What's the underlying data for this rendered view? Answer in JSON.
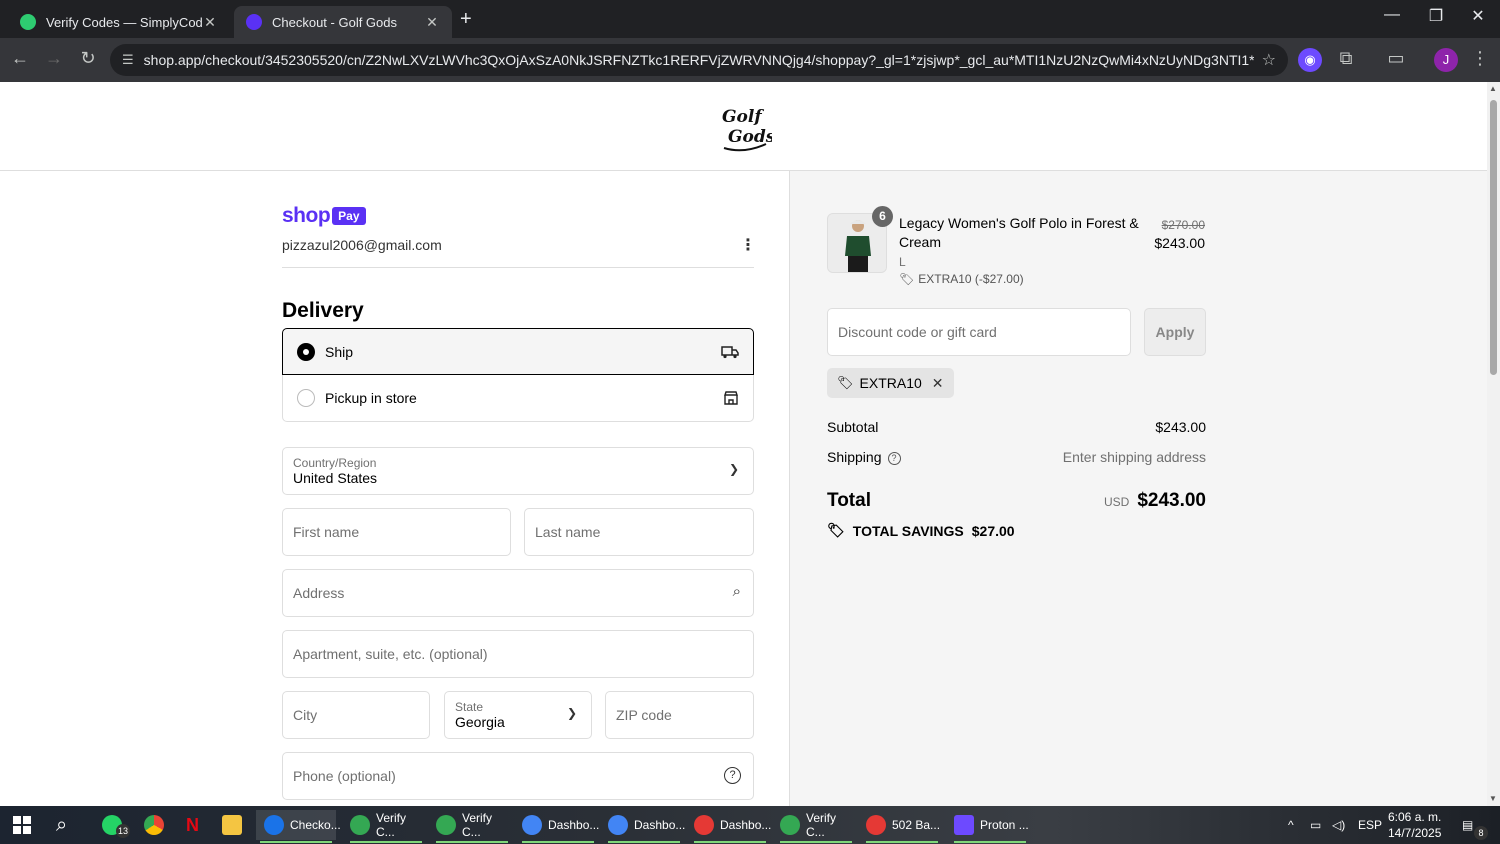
{
  "browser": {
    "tabs": [
      {
        "title": "Verify Codes — SimplyCodes",
        "active": false
      },
      {
        "title": "Checkout - Golf Gods",
        "active": true
      }
    ],
    "url": "shop.app/checkout/3452305520/cn/Z2NwLXVzLWVhc3QxOjAxSzA0NkJSRFNZTkc1RERFVjZWRVNNQjg4/shoppay?_gl=1*zjsjwp*_gcl_au*MTI1NzU2NzQwMi4xNzUyNDg3NTI1*_ga*MTkwM...",
    "profile_initial": "J"
  },
  "store": {
    "logo_text": "Golf Gods"
  },
  "checkout": {
    "shoppay_shop": "shop",
    "shoppay_pay": "Pay",
    "email": "pizzazul2006@gmail.com",
    "delivery_heading": "Delivery",
    "options": {
      "ship": "Ship",
      "pickup": "Pickup in store"
    },
    "fields": {
      "country_label": "Country/Region",
      "country_value": "United States",
      "first_name": "First name",
      "last_name": "Last name",
      "address": "Address",
      "apartment": "Apartment, suite, etc. (optional)",
      "city": "City",
      "state_label": "State",
      "state_value": "Georgia",
      "zip": "ZIP code",
      "phone": "Phone (optional)"
    }
  },
  "summary": {
    "item": {
      "quantity": "6",
      "name": "Legacy Women's Golf Polo in Forest & Cream",
      "variant": "L",
      "discount": "EXTRA10 (-$27.00)",
      "original_price": "$270.00",
      "price": "$243.00"
    },
    "discount_placeholder": "Discount code or gift card",
    "apply_label": "Apply",
    "applied_code": "EXTRA10",
    "subtotal_label": "Subtotal",
    "subtotal_value": "$243.00",
    "shipping_label": "Shipping",
    "shipping_value": "Enter shipping address",
    "total_label": "Total",
    "currency": "USD",
    "total_value": "$243.00",
    "savings_label": "TOTAL SAVINGS",
    "savings_value": "$27.00"
  },
  "taskbar": {
    "whatsapp_badge": "13",
    "items": [
      {
        "label": "Checko...",
        "color": "#1a73e8"
      },
      {
        "label": "Verify C...",
        "color": "#34a853"
      },
      {
        "label": "Verify C...",
        "color": "#34a853"
      },
      {
        "label": "Dashbo...",
        "color": "#4285f4"
      },
      {
        "label": "Dashbo...",
        "color": "#4285f4"
      },
      {
        "label": "Dashbo...",
        "color": "#e53935"
      },
      {
        "label": "Verify C...",
        "color": "#34a853"
      },
      {
        "label": "502 Ba...",
        "color": "#e53935"
      },
      {
        "label": "Proton ...",
        "color": "#6d4aff"
      }
    ],
    "language": "ESP",
    "time": "6:06 a. m.",
    "date": "14/7/2025",
    "notifications": "8"
  },
  "colors": {
    "shop_purple": "#5a31f4",
    "summary_bg": "#f5f5f5",
    "chrome_dark": "#202124"
  }
}
